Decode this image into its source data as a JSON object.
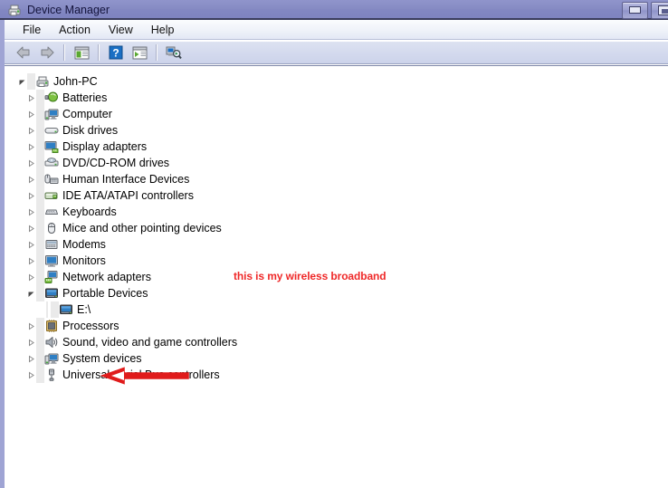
{
  "window": {
    "title": "Device Manager",
    "title_icon": "device-manager-icon",
    "buttons": {
      "minimize": "Minimize",
      "maximize": "Maximize"
    }
  },
  "menubar": {
    "items": [
      {
        "label": "File",
        "name": "menu-file"
      },
      {
        "label": "Action",
        "name": "menu-action"
      },
      {
        "label": "View",
        "name": "menu-view"
      },
      {
        "label": "Help",
        "name": "menu-help"
      }
    ]
  },
  "toolbar": {
    "items": [
      {
        "name": "back-button",
        "icon": "back-arrow-icon",
        "title": "Back"
      },
      {
        "name": "forward-button",
        "icon": "forward-arrow-icon",
        "title": "Forward"
      },
      {
        "name": "show-hide-console-tree-button",
        "icon": "console-tree-icon",
        "title": "Show/Hide Console Tree"
      },
      {
        "name": "help-button",
        "icon": "question-mark-icon",
        "title": "Help"
      },
      {
        "name": "properties-button",
        "icon": "properties-icon",
        "title": "Properties"
      },
      {
        "name": "scan-hardware-changes-button",
        "icon": "scan-hardware-icon",
        "title": "Scan for hardware changes"
      }
    ]
  },
  "tree": {
    "root": {
      "label": "John-PC",
      "icon": "computer-tower-icon",
      "expanded": true
    },
    "items": [
      {
        "label": "Batteries",
        "icon": "battery-icon",
        "expanded": false
      },
      {
        "label": "Computer",
        "icon": "computer-icon",
        "expanded": false
      },
      {
        "label": "Disk drives",
        "icon": "disk-drive-icon",
        "expanded": false
      },
      {
        "label": "Display adapters",
        "icon": "display-adapter-icon",
        "expanded": false
      },
      {
        "label": "DVD/CD-ROM drives",
        "icon": "dvd-drive-icon",
        "expanded": false
      },
      {
        "label": "Human Interface Devices",
        "icon": "hid-icon",
        "expanded": false
      },
      {
        "label": "IDE ATA/ATAPI controllers",
        "icon": "ide-controller-icon",
        "expanded": false
      },
      {
        "label": "Keyboards",
        "icon": "keyboard-icon",
        "expanded": false
      },
      {
        "label": "Mice and other pointing devices",
        "icon": "mouse-icon",
        "expanded": false
      },
      {
        "label": "Modems",
        "icon": "modem-icon",
        "expanded": false
      },
      {
        "label": "Monitors",
        "icon": "monitor-icon",
        "expanded": false
      },
      {
        "label": "Network adapters",
        "icon": "network-adapter-icon",
        "expanded": false
      },
      {
        "label": "Portable Devices",
        "icon": "portable-device-icon",
        "expanded": true,
        "children": [
          {
            "label": "E:\\",
            "icon": "portable-device-icon"
          }
        ]
      },
      {
        "label": "Processors",
        "icon": "processor-icon",
        "expanded": false
      },
      {
        "label": "Sound, video and game controllers",
        "icon": "sound-controller-icon",
        "expanded": false
      },
      {
        "label": "System devices",
        "icon": "system-device-icon",
        "expanded": false
      },
      {
        "label": "Universal Serial Bus controllers",
        "icon": "usb-controller-icon",
        "expanded": false
      }
    ]
  },
  "annotation": {
    "text": "this is my wireless broadband",
    "color": "#ef2929",
    "arrow": "left-pointing-arrow"
  }
}
